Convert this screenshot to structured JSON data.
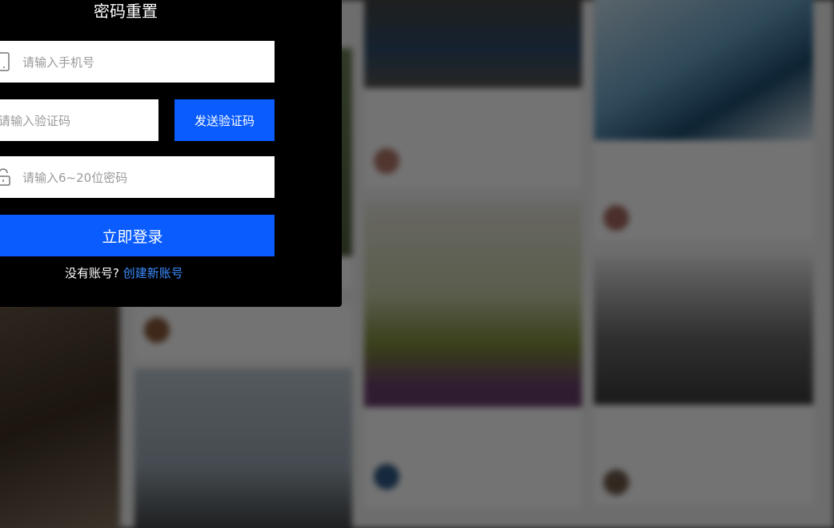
{
  "modal": {
    "title": "密码重置",
    "phone_placeholder": "请输入手机号",
    "code_placeholder": "请输入验证码",
    "send_code_label": "发送验证码",
    "password_placeholder": "请输入6~20位密码",
    "submit_label": "立即登录",
    "no_account_text": "没有账号?",
    "create_account_link": "创建新账号"
  },
  "colors": {
    "primary": "#0a5cff",
    "link": "#3b8cff",
    "modal_bg": "#000000"
  },
  "feed": {
    "cards": [
      {
        "title": "",
        "user": "",
        "likes": ""
      }
    ]
  }
}
